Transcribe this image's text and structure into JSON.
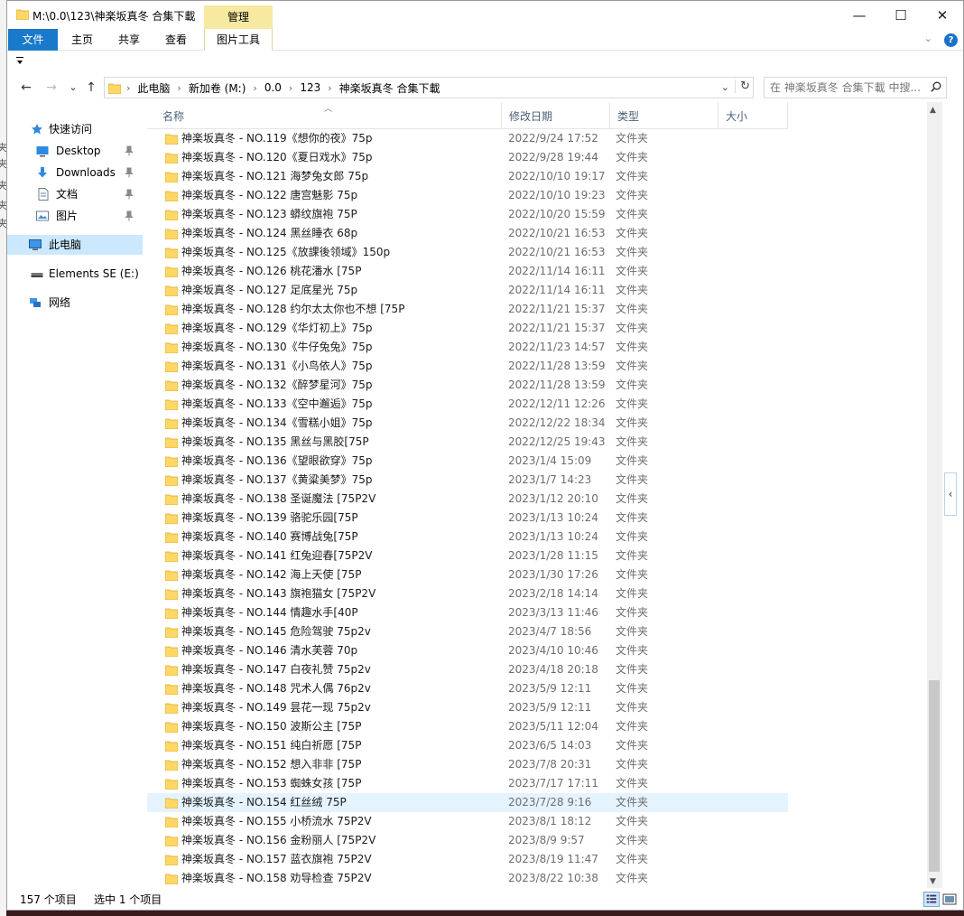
{
  "window": {
    "title": "M:\\0.0\\123\\神楽坂真冬 合集下載",
    "manage_tab": "管理",
    "controls": {
      "minimize": "—",
      "maximize": "☐",
      "close": "✕"
    }
  },
  "ribbon": {
    "tabs": [
      "文件",
      "主页",
      "共享",
      "查看"
    ],
    "tools_tab": "图片工具",
    "help": "?"
  },
  "nav": {
    "back": "←",
    "forward": "→",
    "recent": "⌄",
    "up": "↑",
    "address_segments": [
      "此电脑",
      "新加卷 (M:)",
      "0.0",
      "123",
      "神楽坂真冬 合集下載"
    ],
    "search_placeholder": "在 神楽坂真冬 合集下載 中搜..."
  },
  "sidebar": {
    "quick_access": "快速访问",
    "pinned": [
      "Desktop",
      "Downloads",
      "文档",
      "图片"
    ],
    "this_pc": "此电脑",
    "drive": "Elements SE (E:)",
    "network": "网络"
  },
  "columns": {
    "name": "名称",
    "date": "修改日期",
    "type": "类型",
    "size": "大小"
  },
  "files": [
    {
      "name": "神楽坂真冬 - NO.119《想你的夜》75p",
      "date": "2022/9/24 17:52",
      "type": "文件夹"
    },
    {
      "name": "神楽坂真冬 - NO.120《夏日戏水》75p",
      "date": "2022/9/28 19:44",
      "type": "文件夹"
    },
    {
      "name": "神楽坂真冬 - NO.121 海梦兔女郎 75p",
      "date": "2022/10/10 19:17",
      "type": "文件夹"
    },
    {
      "name": "神楽坂真冬 - NO.122 唐宫魅影 75p",
      "date": "2022/10/10 19:23",
      "type": "文件夹"
    },
    {
      "name": "神楽坂真冬 - NO.123 蟒纹旗袍 75P",
      "date": "2022/10/20 15:59",
      "type": "文件夹"
    },
    {
      "name": "神楽坂真冬 - NO.124 黑丝睡衣 68p",
      "date": "2022/10/21 16:53",
      "type": "文件夹"
    },
    {
      "name": "神楽坂真冬 - NO.125《放課後领域》150p",
      "date": "2022/10/21 16:53",
      "type": "文件夹"
    },
    {
      "name": "神楽坂真冬 - NO.126 桃花潘水 [75P",
      "date": "2022/11/14 16:11",
      "type": "文件夹"
    },
    {
      "name": "神楽坂真冬 - NO.127 足底星光 75p",
      "date": "2022/11/14 16:11",
      "type": "文件夹"
    },
    {
      "name": "神楽坂真冬 - NO.128 约尔太太你也不想 [75P",
      "date": "2022/11/21 15:37",
      "type": "文件夹"
    },
    {
      "name": "神楽坂真冬 - NO.129《华灯初上》75p",
      "date": "2022/11/21 15:37",
      "type": "文件夹"
    },
    {
      "name": "神楽坂真冬 - NO.130《牛仔兔兔》75p",
      "date": "2022/11/23 14:57",
      "type": "文件夹"
    },
    {
      "name": "神楽坂真冬 - NO.131《小鸟依人》75p",
      "date": "2022/11/28 13:59",
      "type": "文件夹"
    },
    {
      "name": "神楽坂真冬 - NO.132《醉梦星河》75p",
      "date": "2022/11/28 13:59",
      "type": "文件夹"
    },
    {
      "name": "神楽坂真冬 - NO.133《空中邂逅》75p",
      "date": "2022/12/11 12:26",
      "type": "文件夹"
    },
    {
      "name": "神楽坂真冬 - NO.134《雪糕小姐》75p",
      "date": "2022/12/22 18:34",
      "type": "文件夹"
    },
    {
      "name": "神楽坂真冬 - NO.135 黑丝与黑胶[75P",
      "date": "2022/12/25 19:43",
      "type": "文件夹"
    },
    {
      "name": "神楽坂真冬 - NO.136《望眼欲穿》75p",
      "date": "2023/1/4 15:09",
      "type": "文件夹"
    },
    {
      "name": "神楽坂真冬 - NO.137《黄粱美梦》75p",
      "date": "2023/1/7 14:23",
      "type": "文件夹"
    },
    {
      "name": "神楽坂真冬 - NO.138 圣诞魔法 [75P2V",
      "date": "2023/1/12 20:10",
      "type": "文件夹"
    },
    {
      "name": "神楽坂真冬 - NO.139 骆驼乐园[75P",
      "date": "2023/1/13 10:24",
      "type": "文件夹"
    },
    {
      "name": "神楽坂真冬 - NO.140 赛博战兔[75P",
      "date": "2023/1/13 10:24",
      "type": "文件夹"
    },
    {
      "name": "神楽坂真冬 - NO.141 红兔迎春[75P2V",
      "date": "2023/1/28 11:15",
      "type": "文件夹"
    },
    {
      "name": "神楽坂真冬 - NO.142 海上天使 [75P",
      "date": "2023/1/30 17:26",
      "type": "文件夹"
    },
    {
      "name": "神楽坂真冬 - NO.143 旗袍猫女 [75P2V",
      "date": "2023/2/18 14:14",
      "type": "文件夹"
    },
    {
      "name": "神楽坂真冬 - NO.144 情趣水手[40P",
      "date": "2023/3/13 11:46",
      "type": "文件夹"
    },
    {
      "name": "神楽坂真冬 - NO.145 危险驾驶 75p2v",
      "date": "2023/4/7 18:56",
      "type": "文件夹"
    },
    {
      "name": "神楽坂真冬 - NO.146 清水芙蓉 70p",
      "date": "2023/4/10 10:46",
      "type": "文件夹"
    },
    {
      "name": "神楽坂真冬 - NO.147 白夜礼赞 75p2v",
      "date": "2023/4/18 20:18",
      "type": "文件夹"
    },
    {
      "name": "神楽坂真冬 - NO.148 咒术人偶 76p2v",
      "date": "2023/5/9 12:11",
      "type": "文件夹"
    },
    {
      "name": "神楽坂真冬 - NO.149 昙花一现 75p2v",
      "date": "2023/5/9 12:11",
      "type": "文件夹"
    },
    {
      "name": "神楽坂真冬 - NO.150 波斯公主 [75P",
      "date": "2023/5/11 12:04",
      "type": "文件夹"
    },
    {
      "name": "神楽坂真冬 - NO.151 纯白祈愿 [75P",
      "date": "2023/6/5 14:03",
      "type": "文件夹"
    },
    {
      "name": "神楽坂真冬 - NO.152 想入非非 [75P",
      "date": "2023/7/8 20:31",
      "type": "文件夹"
    },
    {
      "name": "神楽坂真冬 - NO.153 蜘蛛女孩 [75P",
      "date": "2023/7/17 17:11",
      "type": "文件夹"
    },
    {
      "name": "神楽坂真冬 - NO.154 红丝绒 75P",
      "date": "2023/7/28 9:16",
      "type": "文件夹",
      "selected": true
    },
    {
      "name": "神楽坂真冬 - NO.155 小桥流水 75P2V",
      "date": "2023/8/1 18:12",
      "type": "文件夹"
    },
    {
      "name": "神楽坂真冬 - NO.156 金粉丽人 [75P2V",
      "date": "2023/8/9 9:57",
      "type": "文件夹"
    },
    {
      "name": "神楽坂真冬 - NO.157 蓝衣旗袍 75P2V",
      "date": "2023/8/19 11:47",
      "type": "文件夹"
    },
    {
      "name": "神楽坂真冬 - NO.158 劝导检查 75P2V",
      "date": "2023/8/22 10:38",
      "type": "文件夹"
    }
  ],
  "status": {
    "count": "157 个项目",
    "selected": "选中 1 个项目"
  },
  "colors": {
    "accent": "#1979ca",
    "selection": "#e5f3ff",
    "folder": "#ffd766",
    "manage": "#f7e9a0"
  }
}
